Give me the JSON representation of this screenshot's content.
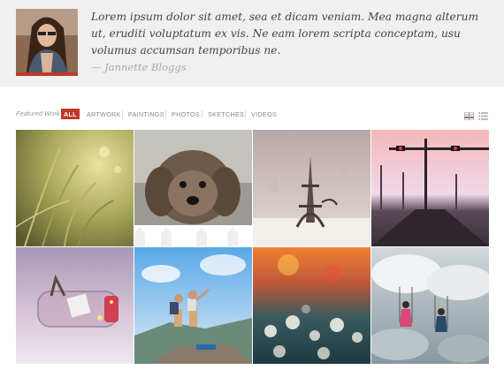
{
  "testimonial": {
    "quote": "Lorem ipsum dolor sit amet, sea et dicam veniam. Mea magna alterum ut, eruditi voluptatum ex vis. Ne eam lorem scripta conceptam, usu volumus accumsan temporibus ne.",
    "author": "— Jannette Bloggs",
    "avatar": "woman-portrait-photo"
  },
  "filters": {
    "label": "Featured Work",
    "items": [
      {
        "label": "ALL",
        "active": true
      },
      {
        "label": "ARTWORK",
        "active": false
      },
      {
        "label": "PAINTINGS",
        "active": false
      },
      {
        "label": "PHOTOS",
        "active": false
      },
      {
        "label": "SKETCHES",
        "active": false
      },
      {
        "label": "VIDEOS",
        "active": false
      }
    ],
    "views": [
      {
        "icon": "grid-view-icon",
        "active": true
      },
      {
        "icon": "list-view-icon",
        "active": false
      }
    ]
  },
  "gallery": [
    {
      "subject": "grass-closeup-photo"
    },
    {
      "subject": "fluffy-dog-photo"
    },
    {
      "subject": "eiffel-tower-figurine-photo"
    },
    {
      "subject": "street-traffic-lights-photo"
    },
    {
      "subject": "dreams-jar-photo"
    },
    {
      "subject": "hikers-mountain-photo"
    },
    {
      "subject": "dandelion-field-photo"
    },
    {
      "subject": "swings-clouds-photo"
    }
  ],
  "colors": {
    "accent": "#c0392b",
    "band": "#f0f0f0"
  }
}
